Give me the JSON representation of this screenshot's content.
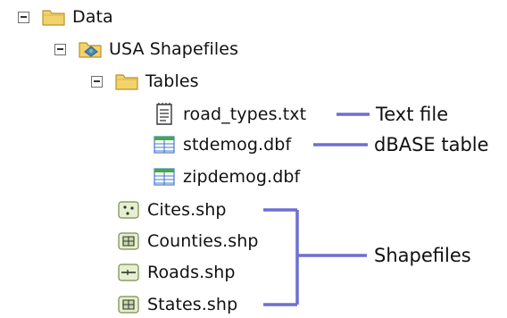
{
  "tree": {
    "data_label": "Data",
    "usa_label": "USA Shapefiles",
    "tables_label": "Tables",
    "road_types_label": "road_types.txt",
    "stdemog_label": "stdemog.dbf",
    "zipdemog_label": "zipdemog.dbf",
    "cites_label": "Cites.shp",
    "counties_label": "Counties.shp",
    "roads_label": "Roads.shp",
    "states_label": "States.shp"
  },
  "callouts": {
    "text_file": "Text file",
    "dbase_table": "dBASE table",
    "shapefiles": "Shapefiles"
  },
  "colors": {
    "connector": "#6f6fd0",
    "folder_fill": "#f2d36a",
    "folder_stroke": "#b8922c",
    "dbf_green": "#3cae3c",
    "dbf_blue": "#4a78c8",
    "shp_fill": "#e6efd0",
    "shp_stroke": "#7a8a4a"
  },
  "icons": {
    "data": "folder-icon",
    "usa": "geodatabase-folder-icon",
    "tables": "folder-icon",
    "road_types": "text-document-icon",
    "stdemog": "dbase-table-icon",
    "zipdemog": "dbase-table-icon",
    "cites": "point-shapefile-icon",
    "counties": "polygon-shapefile-icon",
    "roads": "line-shapefile-icon",
    "states": "polygon-shapefile-icon"
  }
}
